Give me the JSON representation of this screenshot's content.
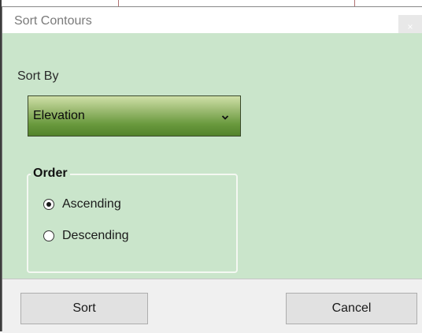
{
  "dialog": {
    "title": "Sort Contours",
    "close_label": "×"
  },
  "sort_by": {
    "label": "Sort By",
    "selected": "Elevation"
  },
  "order": {
    "legend": "Order",
    "options": [
      {
        "label": "Ascending",
        "checked": true
      },
      {
        "label": "Descending",
        "checked": false
      }
    ]
  },
  "buttons": {
    "sort_label": "Sort",
    "cancel_label": "Cancel"
  }
}
